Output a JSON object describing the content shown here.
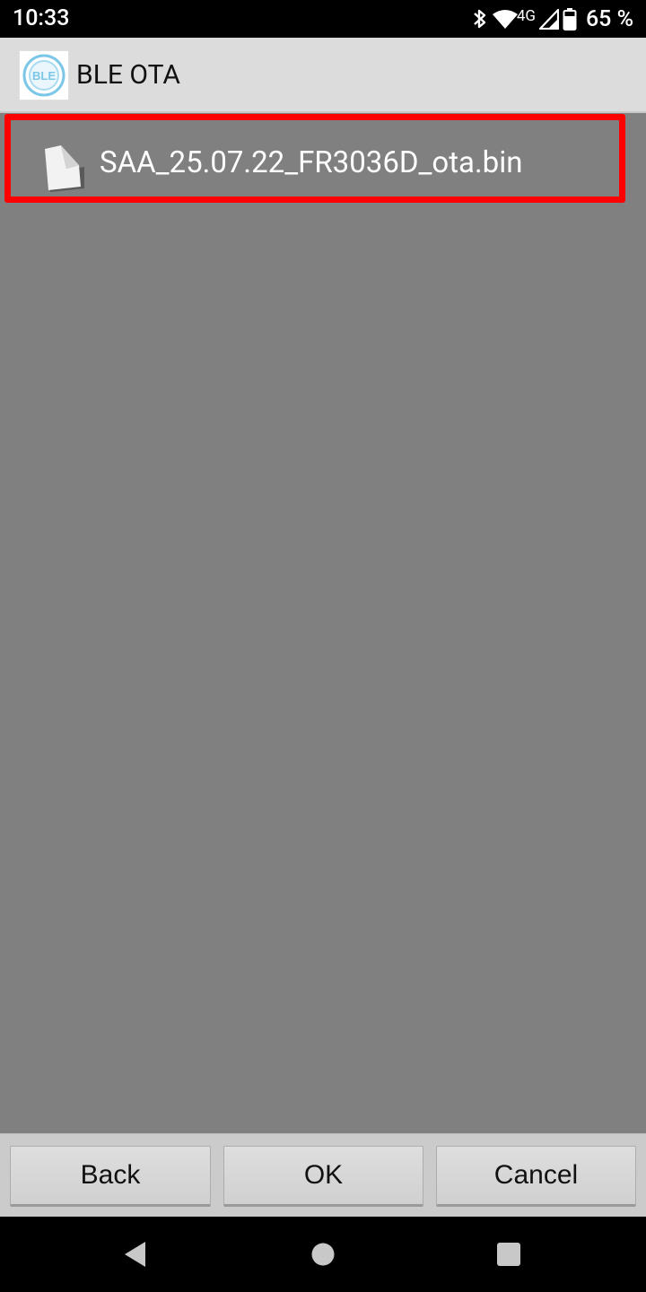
{
  "status_bar": {
    "time": "10:33",
    "network": "4G",
    "battery": "65 %"
  },
  "app_bar": {
    "logo_text": "BLE",
    "title": "BLE OTA"
  },
  "file_list": {
    "items": [
      {
        "name": "SAA_25.07.22_FR3036D_ota.bin",
        "icon": "file-icon",
        "highlighted": true
      }
    ]
  },
  "buttons": {
    "back": "Back",
    "ok": "OK",
    "cancel": "Cancel"
  },
  "nav_bar": {
    "back": "back-icon",
    "home": "home-icon",
    "recents": "recents-icon"
  },
  "colors": {
    "highlight_border": "#ff0000",
    "content_background": "#808080",
    "app_bar_background": "#dcdcdc",
    "logo_accent": "#7cc7e8"
  }
}
